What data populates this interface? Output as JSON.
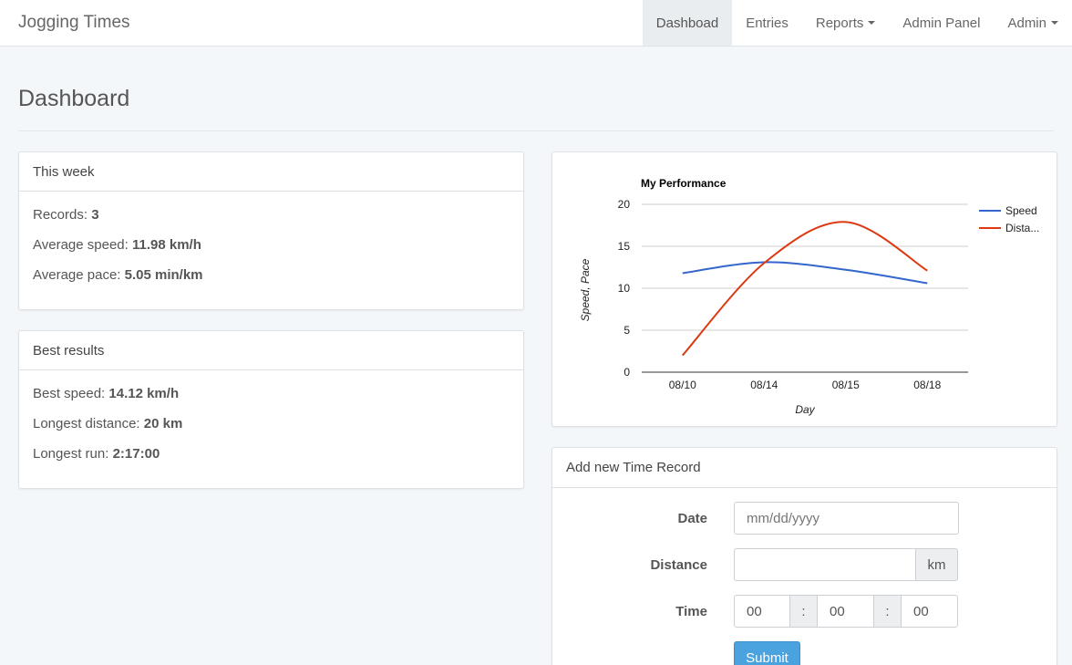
{
  "navbar": {
    "brand": "Jogging Times",
    "items": [
      {
        "label": "Dashboad",
        "active": true
      },
      {
        "label": "Entries"
      },
      {
        "label": "Reports",
        "dropdown": true
      },
      {
        "label": "Admin Panel"
      },
      {
        "label": "Admin",
        "dropdown": true
      }
    ]
  },
  "page": {
    "title": "Dashboard"
  },
  "this_week": {
    "heading": "This week",
    "records_label": "Records:",
    "records_value": "3",
    "speed_label": "Average speed:",
    "speed_value": "11.98 km/h",
    "pace_label": "Average pace:",
    "pace_value": "5.05 min/km"
  },
  "best_results": {
    "heading": "Best results",
    "speed_label": "Best speed:",
    "speed_value": "14.12 km/h",
    "distance_label": "Longest distance:",
    "distance_value": "20 km",
    "run_label": "Longest run:",
    "run_value": "2:17:00"
  },
  "chart_data": {
    "type": "line",
    "title": "My Performance",
    "xlabel": "Day",
    "ylabel": "Speed, Pace",
    "categories": [
      "08/10",
      "08/14",
      "08/15",
      "08/18"
    ],
    "ylim": [
      0,
      20
    ],
    "yticks": [
      "0",
      "5",
      "10",
      "15",
      "20"
    ],
    "grid": true,
    "legend_position": "right",
    "series": [
      {
        "name": "Speed",
        "legend_label": "Speed",
        "color": "#3366cc",
        "values": [
          11.8,
          13.1,
          12.2,
          10.6
        ]
      },
      {
        "name": "Distance",
        "legend_label": "Dista...",
        "color": "#dc3912",
        "values": [
          2.0,
          13.0,
          17.9,
          12.1
        ]
      }
    ]
  },
  "add_record": {
    "heading": "Add new Time Record",
    "date_label": "Date",
    "date_placeholder": "mm/dd/yyyy",
    "distance_label": "Distance",
    "distance_unit": "km",
    "time_label": "Time",
    "time_hours": "00",
    "time_minutes": "00",
    "time_seconds": "00",
    "separator": ":",
    "submit_label": "Submit"
  }
}
